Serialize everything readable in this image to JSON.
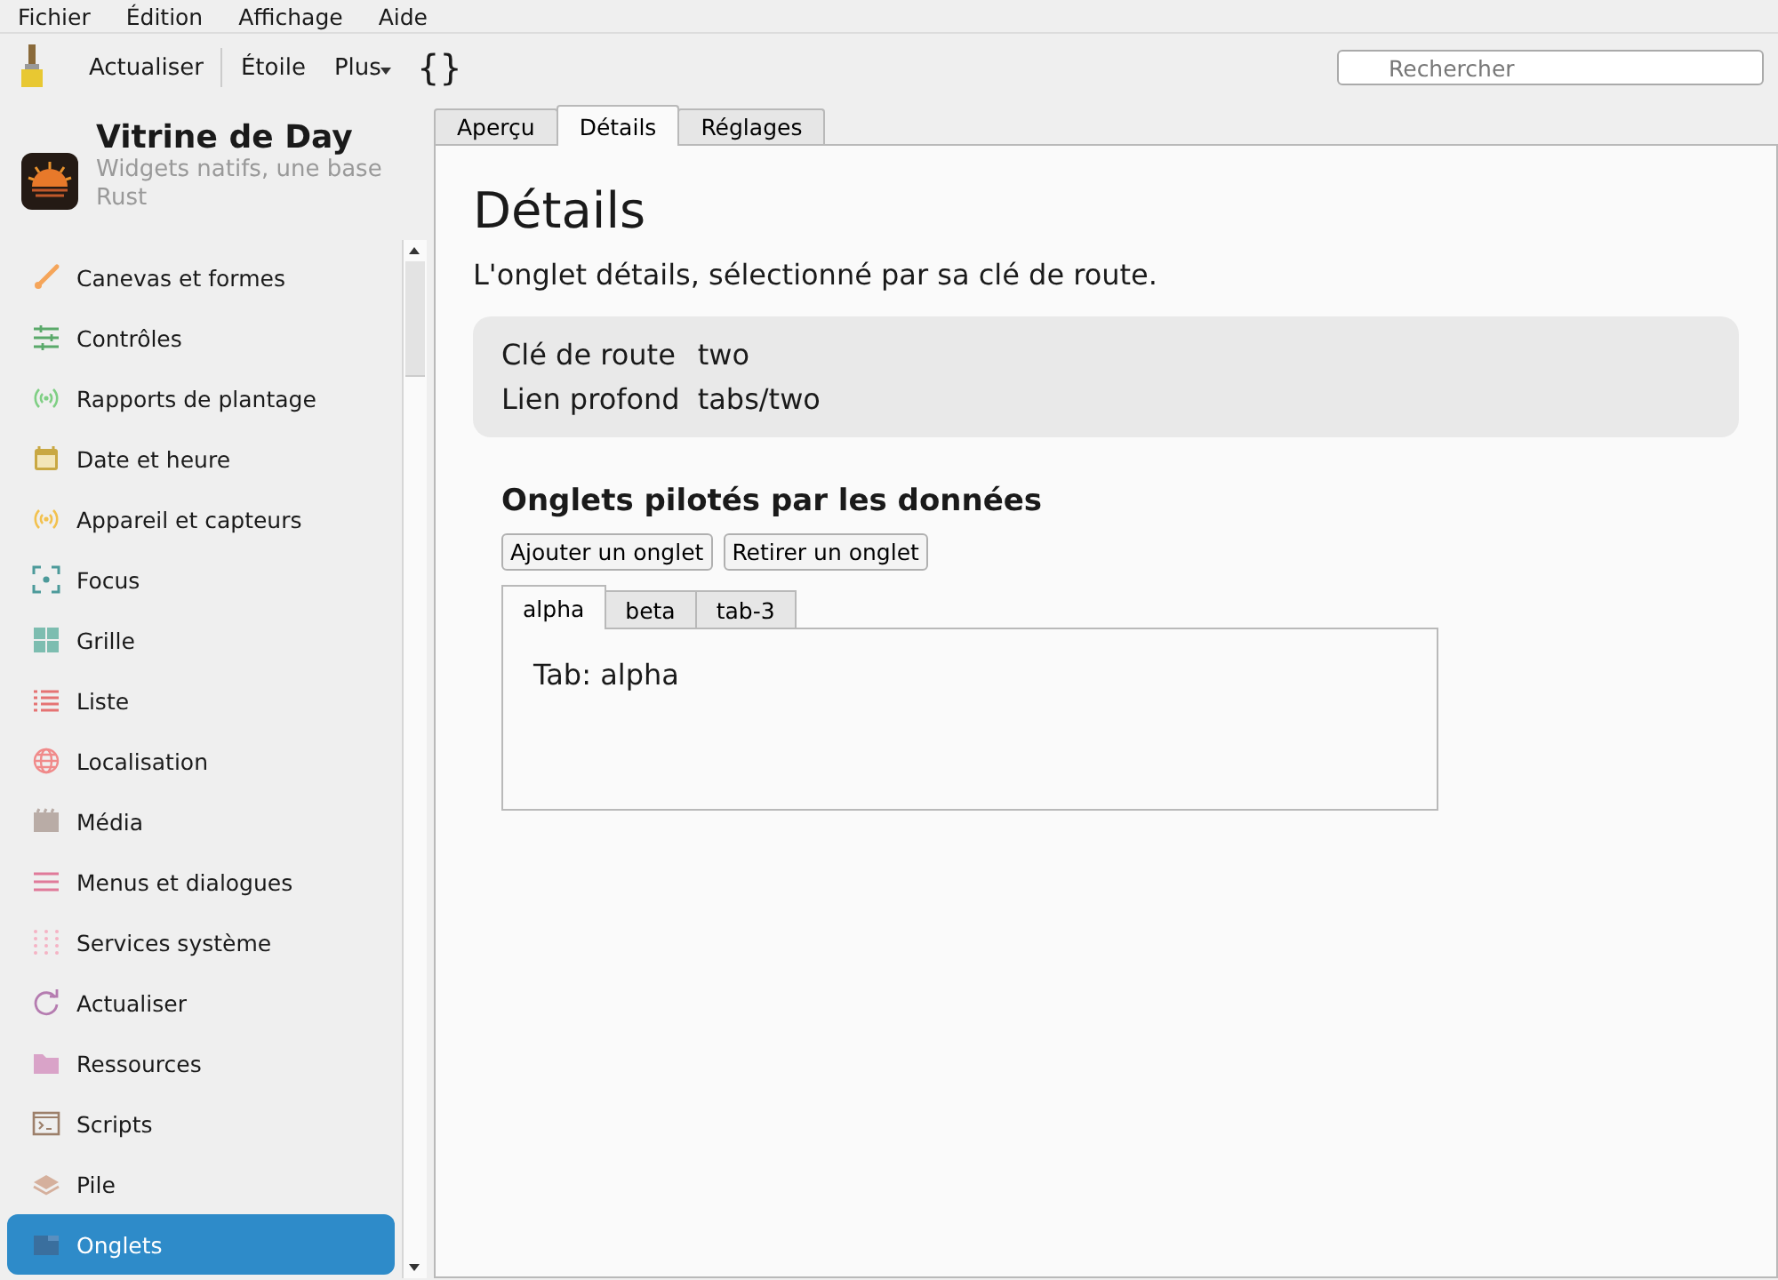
{
  "menu": [
    "Fichier",
    "Édition",
    "Affichage",
    "Aide"
  ],
  "toolbar": {
    "buttons": [
      {
        "label": "Actualiser",
        "kind": "text"
      },
      {
        "label": "Étoile",
        "kind": "text"
      },
      {
        "label": "Plus",
        "kind": "dropdown"
      },
      {
        "label": "{}",
        "kind": "text"
      }
    ],
    "search": {
      "placeholder": "Rechercher"
    }
  },
  "sidebar": {
    "title": "Vitrine de Day",
    "subtitle": "Widgets natifs, une base Rust",
    "items": [
      {
        "label": "Canevas et formes",
        "kind": "brush",
        "selected": false
      },
      {
        "label": "Contrôles",
        "kind": "sliders",
        "selected": false
      },
      {
        "label": "Rapports de plantage",
        "kind": "signal-green",
        "selected": false
      },
      {
        "label": "Date et heure",
        "kind": "calendar",
        "selected": false
      },
      {
        "label": "Appareil et capteurs",
        "kind": "signal-yellow",
        "selected": false
      },
      {
        "label": "Focus",
        "kind": "focus",
        "selected": false
      },
      {
        "label": "Grille",
        "kind": "grid",
        "selected": false
      },
      {
        "label": "Liste",
        "kind": "list",
        "selected": false
      },
      {
        "label": "Localisation",
        "kind": "globe",
        "selected": false
      },
      {
        "label": "Média",
        "kind": "clapper",
        "selected": false
      },
      {
        "label": "Menus et dialogues",
        "kind": "menu",
        "selected": false
      },
      {
        "label": "Services système",
        "kind": "dots",
        "selected": false
      },
      {
        "label": "Actualiser",
        "kind": "refresh",
        "selected": false
      },
      {
        "label": "Ressources",
        "kind": "folder",
        "selected": false
      },
      {
        "label": "Scripts",
        "kind": "terminal",
        "selected": false
      },
      {
        "label": "Pile",
        "kind": "stack",
        "selected": false
      },
      {
        "label": "Onglets",
        "kind": "tabs",
        "selected": true
      }
    ]
  },
  "tabs": [
    {
      "label": "Aperçu",
      "selected": false
    },
    {
      "label": "Détails",
      "selected": true
    },
    {
      "label": "Réglages",
      "selected": false
    }
  ],
  "content": {
    "heading": "Détails",
    "description": "L'onglet détails, sélectionné par sa clé de route.",
    "info": [
      {
        "label": "Clé de route",
        "value": "two"
      },
      {
        "label": "Lien profond",
        "value": "tabs/two"
      }
    ],
    "section_title": "Onglets pilotés par les données",
    "buttons": [
      "Ajouter un onglet",
      "Retirer un onglet"
    ],
    "inner_tabs": [
      {
        "label": "alpha",
        "selected": true
      },
      {
        "label": "beta",
        "selected": false
      },
      {
        "label": "tab-3",
        "selected": false
      }
    ],
    "inner_content": "Tab: alpha"
  }
}
